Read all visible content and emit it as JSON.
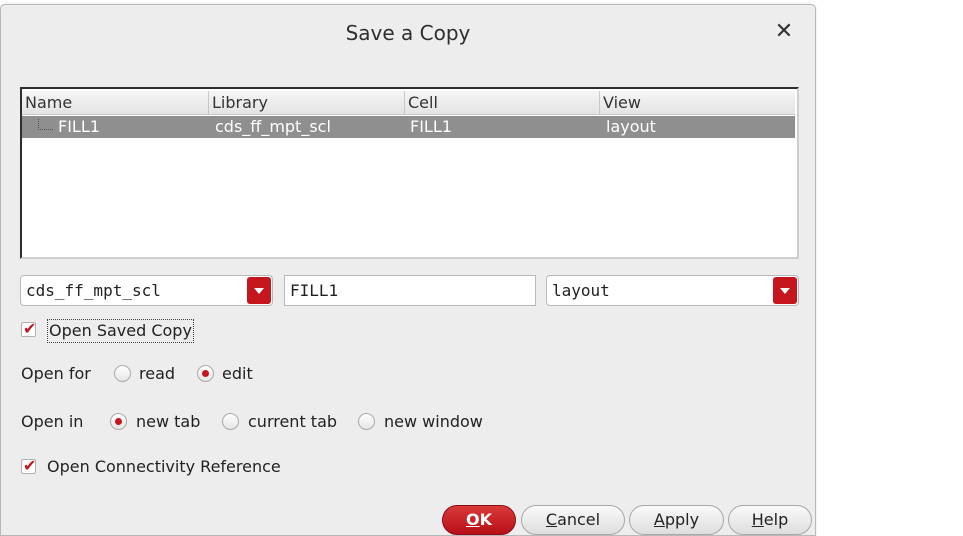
{
  "dialog": {
    "title": "Save a Copy"
  },
  "table": {
    "headers": [
      "Name",
      "Library",
      "Cell",
      "View"
    ],
    "rows": [
      {
        "name": "FILL1",
        "library": "cds_ff_mpt_scl",
        "cell": "FILL1",
        "view": "layout"
      }
    ]
  },
  "fields": {
    "library_value": "cds_ff_mpt_scl",
    "cell_value": "FILL1",
    "view_value": "layout"
  },
  "options": {
    "open_saved_copy": {
      "label": "Open Saved Copy",
      "checked": true
    },
    "open_for": {
      "label": "Open for",
      "choices": [
        "read",
        "edit"
      ],
      "selected": "edit"
    },
    "open_in": {
      "label": "Open in",
      "choices": [
        "new tab",
        "current tab",
        "new window"
      ],
      "selected": "new tab"
    },
    "open_connectivity_reference": {
      "label": "Open Connectivity Reference",
      "checked": true
    }
  },
  "buttons": {
    "ok": {
      "mnemonic": "O",
      "rest": "K"
    },
    "cancel": {
      "mnemonic": "C",
      "rest": "ancel"
    },
    "apply": {
      "mnemonic": "A",
      "rest": "pply"
    },
    "help": {
      "mnemonic": "H",
      "rest": "elp"
    }
  },
  "icons": {
    "close": "close-icon",
    "dropdown": "chevron-down-icon",
    "check": "checkmark-icon"
  },
  "colors": {
    "accent": "#c4161c",
    "selected_row": "#8f8f8f",
    "dialog_bg": "#ededed"
  }
}
